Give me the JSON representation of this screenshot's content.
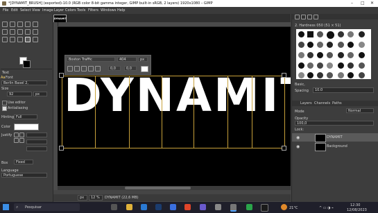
{
  "window": {
    "title": "*[DYNAMIT_BRUSH] (exported)-10.0 (RGB color 8-bit gamma integer, GIMP built-in sRGB, 2 layers) 1920x1080 – GIMP",
    "controls": [
      "–",
      "□",
      "✕"
    ]
  },
  "menu": [
    "File",
    "Edit",
    "Select",
    "View",
    "Image",
    "Layer",
    "Colors",
    "Tools",
    "Filters",
    "Windows",
    "Help"
  ],
  "image_tab": {
    "thumb_label": "DYNAMIT"
  },
  "canvas": {
    "big_text": "DYNAMIT",
    "text_toolbar": {
      "font": "Boston Traffic",
      "size": "404",
      "unit": "px",
      "val1": "0,0",
      "val2": "0,0"
    }
  },
  "tool_options": {
    "section": "Text",
    "font_label": "Font",
    "font_value": "Berlin Basel 2,",
    "size_label": "Size",
    "size_value": "92",
    "size_unit": "px",
    "use_editor": "Use editor",
    "antialiasing": "Antialiasing",
    "hinting_label": "Hinting",
    "hinting_value": "Full",
    "color_label": "Color",
    "justify_label": "Justify",
    "box_label": "Box",
    "box_value": "Fixed",
    "language_label": "Language",
    "language_value": "Portuguese"
  },
  "statusbar": {
    "unit": "px",
    "zoom": "12 %",
    "info": "DYNAMIT (22,6 MB)"
  },
  "brushes": {
    "header": "2. Hardness 050 (51 × 51)",
    "basic_label": "Basic,",
    "spacing_label": "Spacing",
    "spacing_value": "10.0"
  },
  "layers": {
    "tabs": [
      "Layers",
      "Channels",
      "Paths"
    ],
    "mode_label": "Mode",
    "mode_value": "Normal",
    "opacity_label": "Opacity",
    "opacity_value": "100,0",
    "lock_label": "Lock:",
    "items": [
      {
        "name": "DYNAMIT",
        "visible": true
      },
      {
        "name": "Background",
        "visible": true
      }
    ]
  },
  "taskbar": {
    "search_placeholder": "Pesquisar",
    "temperature": "21°C",
    "time": "12:30",
    "date": "12/08/2023"
  },
  "colors": {
    "accent_guide": "#c8a13a",
    "canvas_bg": "#000000",
    "text": "#ffffff"
  }
}
